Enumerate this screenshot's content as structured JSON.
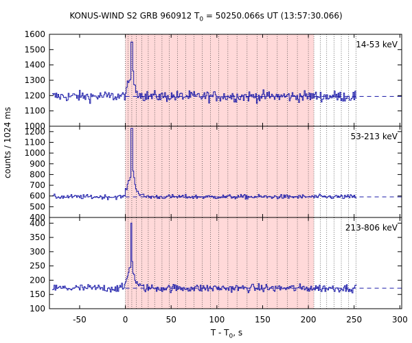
{
  "chart_data": {
    "type": "line",
    "title_parts": {
      "pre": "KONUS-WIND S2 GRB 960912 T",
      "sub": "0",
      "post": " = 50250.066s UT (13:57:30.066)"
    },
    "xlabel_parts": {
      "pre": "T - T",
      "sub": "0",
      "post": ", s"
    },
    "ylabel": "counts / 1024 ms",
    "xlim": [
      -83,
      302
    ],
    "xticks": [
      -50,
      0,
      50,
      100,
      150,
      200,
      250,
      300
    ],
    "grid": false,
    "shaded_interval": {
      "x": [
        0,
        206
      ],
      "color": "#ffd9d9"
    },
    "interval_markers": [
      0,
      3,
      7,
      12,
      18,
      25,
      32,
      40,
      48,
      57,
      66,
      75,
      84,
      93,
      102,
      112,
      122,
      133,
      144,
      155,
      166,
      177,
      188,
      200,
      206,
      213,
      220,
      228,
      236,
      244,
      252
    ],
    "series_color": "#1a1aa8",
    "panels": [
      {
        "name": "14-53 keV",
        "ylim": [
          1000,
          1600
        ],
        "yticks": [
          1000,
          1100,
          1200,
          1300,
          1400,
          1500,
          1600
        ],
        "background": 1195,
        "noise": 25,
        "peak": 1550,
        "peak_time": 6
      },
      {
        "name": "53-213 keV",
        "ylim": [
          400,
          1250
        ],
        "yticks": [
          400,
          500,
          600,
          700,
          800,
          900,
          1000,
          1100,
          1200
        ],
        "background": 592,
        "noise": 15,
        "peak": 1230,
        "peak_time": 6
      },
      {
        "name": "213-806 keV",
        "ylim": [
          100,
          420
        ],
        "yticks": [
          100,
          150,
          200,
          250,
          300,
          350,
          400
        ],
        "background": 172,
        "noise": 10,
        "peak": 400,
        "peak_time": 5
      }
    ]
  }
}
